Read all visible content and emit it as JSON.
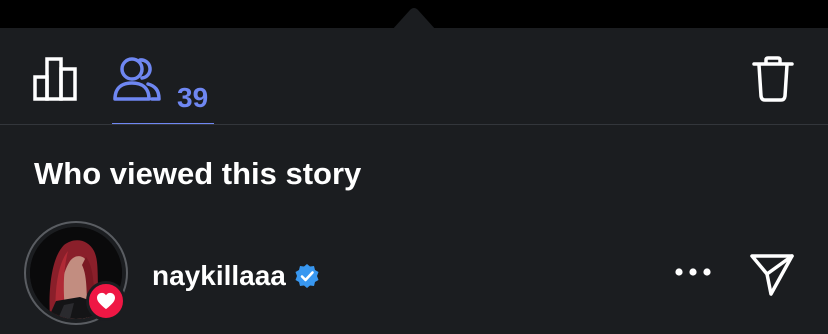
{
  "header": {
    "insights_icon": "bar-chart-icon",
    "viewers_icon": "people-icon",
    "viewers_count": "39",
    "delete_icon": "trash-icon",
    "active_tab": "viewers"
  },
  "section": {
    "title": "Who viewed this story"
  },
  "viewers": [
    {
      "username": "naykillaaa",
      "verified": true,
      "liked": true,
      "avatar_icon": "profile-photo",
      "more_icon": "more-horizontal-icon",
      "send_icon": "send-icon"
    }
  ],
  "colors": {
    "background": "#1b1d20",
    "accent": "#6f87f2",
    "like": "#ef1744",
    "verified": "#3897f0",
    "divider": "#33363b"
  }
}
